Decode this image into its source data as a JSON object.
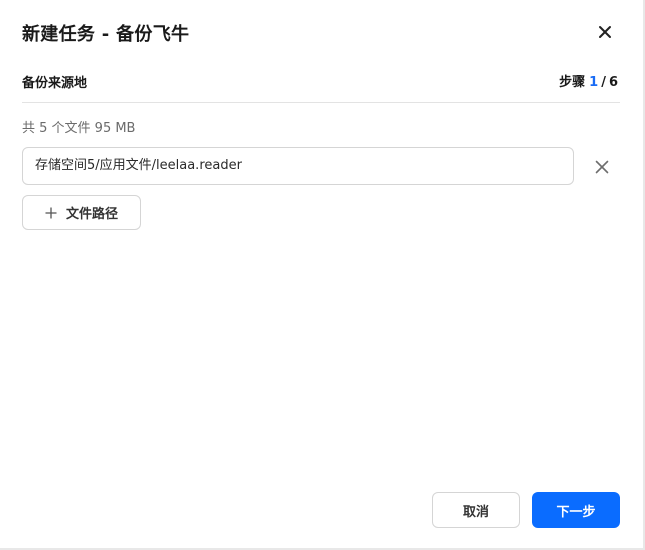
{
  "dialog": {
    "title": "新建任务 - 备份飞牛",
    "close_icon": "close-icon"
  },
  "step": {
    "label": "备份来源地",
    "prefix": "步骤",
    "current": "1",
    "separator": "/",
    "total": "6",
    "accent_color": "#1a6cf5"
  },
  "source": {
    "summary": "共 5 个文件 95 MB",
    "paths": [
      {
        "value": "存储空间5/应用文件/leelaa.reader"
      }
    ],
    "remove_icon": "close-icon",
    "add_path_icon": "plus-icon",
    "add_path_label": "文件路径"
  },
  "footer": {
    "cancel_label": "取消",
    "next_label": "下一步",
    "primary_color": "#0a6cff"
  }
}
